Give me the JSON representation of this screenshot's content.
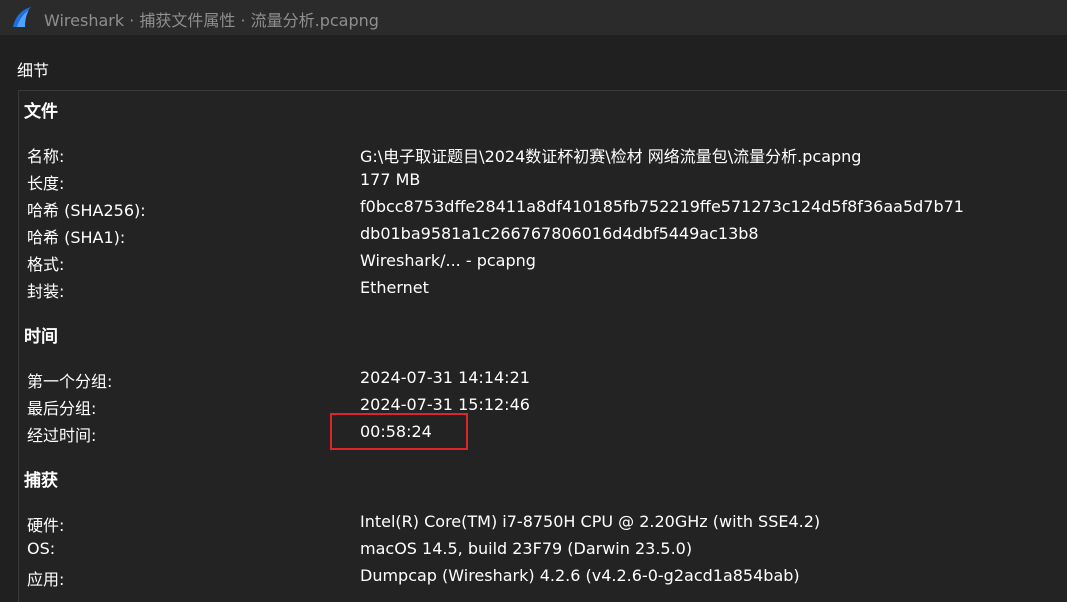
{
  "window": {
    "title": "Wireshark · 捕获文件属性 · 流量分析.pcapng"
  },
  "dialog": {
    "section_label": "细节"
  },
  "file_section": {
    "heading": "文件",
    "rows": [
      {
        "key": "名称:",
        "value": "G:\\电子取证题目\\2024数证杯初赛\\检材 网络流量包\\流量分析.pcapng"
      },
      {
        "key": "长度:",
        "value": "177 MB"
      },
      {
        "key": "哈希 (SHA256):",
        "value": "f0bcc8753dffe28411a8df410185fb752219ffe571273c124d5f8f36aa5d7b71"
      },
      {
        "key": "哈希 (SHA1):",
        "value": "db01ba9581a1c266767806016d4dbf5449ac13b8"
      },
      {
        "key": "格式:",
        "value": "Wireshark/... - pcapng"
      },
      {
        "key": "封装:",
        "value": "Ethernet"
      }
    ]
  },
  "time_section": {
    "heading": "时间",
    "rows": [
      {
        "key": "第一个分组:",
        "value": "2024-07-31 14:14:21"
      },
      {
        "key": "最后分组:",
        "value": "2024-07-31 15:12:46"
      },
      {
        "key": "经过时间:",
        "value": "00:58:24"
      }
    ]
  },
  "capture_section": {
    "heading": "捕获",
    "rows": [
      {
        "key": "硬件:",
        "value": "Intel(R) Core(TM) i7-8750H CPU @ 2.20GHz (with SSE4.2)"
      },
      {
        "key": "OS:",
        "value": "macOS 14.5, build 23F79 (Darwin 23.5.0)"
      },
      {
        "key": "应用:",
        "value": "Dumpcap (Wireshark) 4.2.6 (v4.2.6-0-g2acd1a854bab)"
      }
    ]
  },
  "colors": {
    "background": "#202020",
    "titlebar": "#2b2b2b",
    "highlight": "#d9262c",
    "icon_blue": "#1e6fd9"
  },
  "icons": {
    "app": "wireshark-fin-icon"
  }
}
